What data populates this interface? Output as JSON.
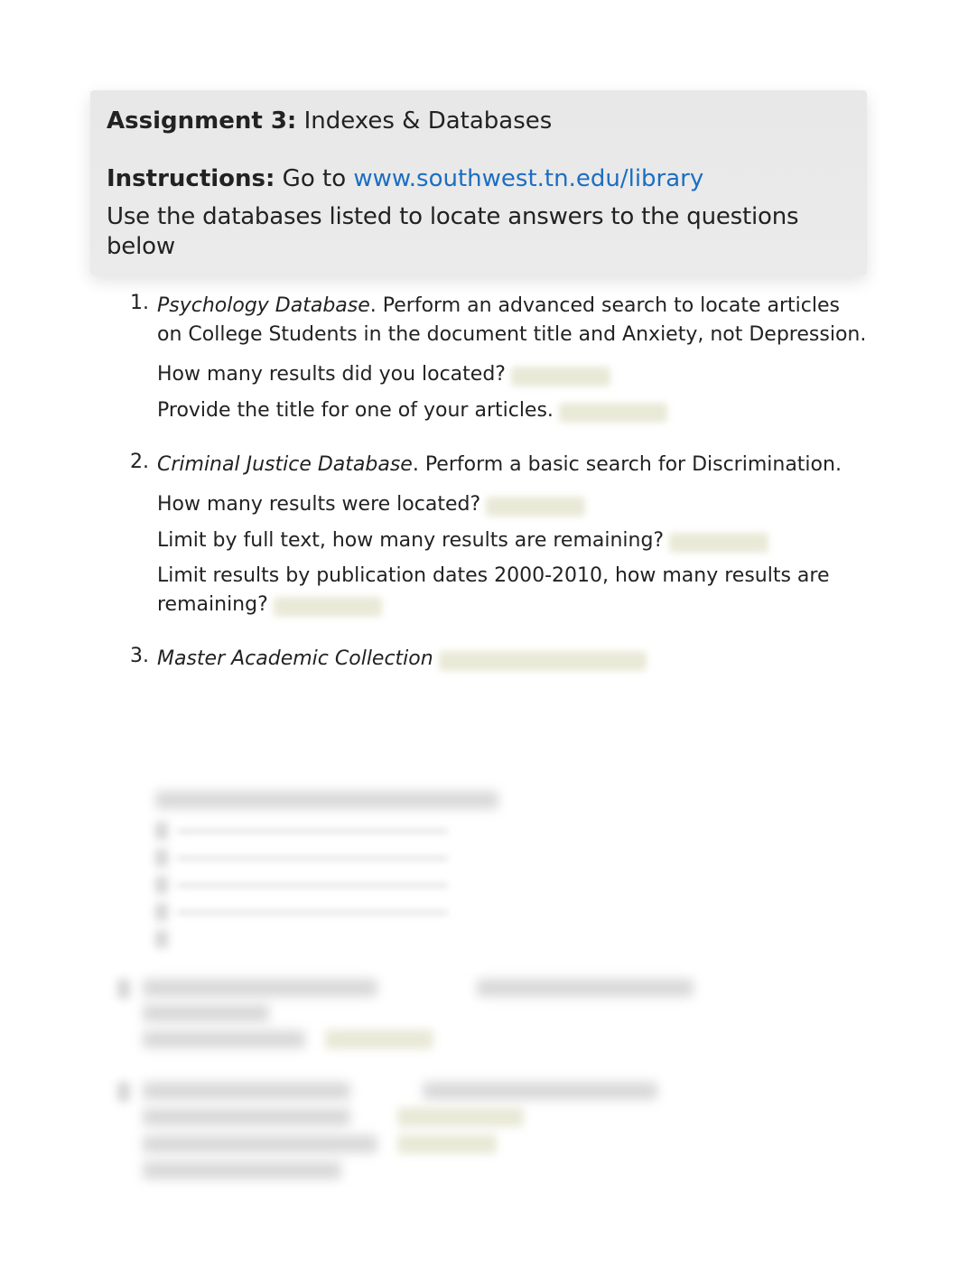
{
  "header": {
    "assignment_label": "Assignment 3:",
    "assignment_title": " Indexes & Databases",
    "instructions_label": "Instructions:",
    "instructions_text": " Go to ",
    "instructions_link_text": "www.southwest.tn.edu/library",
    "instructions_link_href": "http://www.southwest.tn.edu/library",
    "use_line": "Use the databases listed to locate answers to the questions below"
  },
  "items": [
    {
      "number": "1.",
      "db_name": "Psychology Database",
      "intro": ". Perform an advanced search to locate articles on College Students in the document title and Anxiety, not Depression.",
      "questions": [
        "How many results did you located?",
        "Provide the title for one of your articles."
      ]
    },
    {
      "number": "2.",
      "db_name": "Criminal Justice Database",
      "intro": ". Perform a basic search for Discrimination.",
      "questions": [
        "How many results were located?",
        "Limit by full text, how many results are remaining?",
        "Limit results by publication dates 2000-2010, how many results are remaining?"
      ]
    },
    {
      "number": "3.",
      "db_name": "Master Academic Collection",
      "intro": "",
      "questions": []
    }
  ]
}
